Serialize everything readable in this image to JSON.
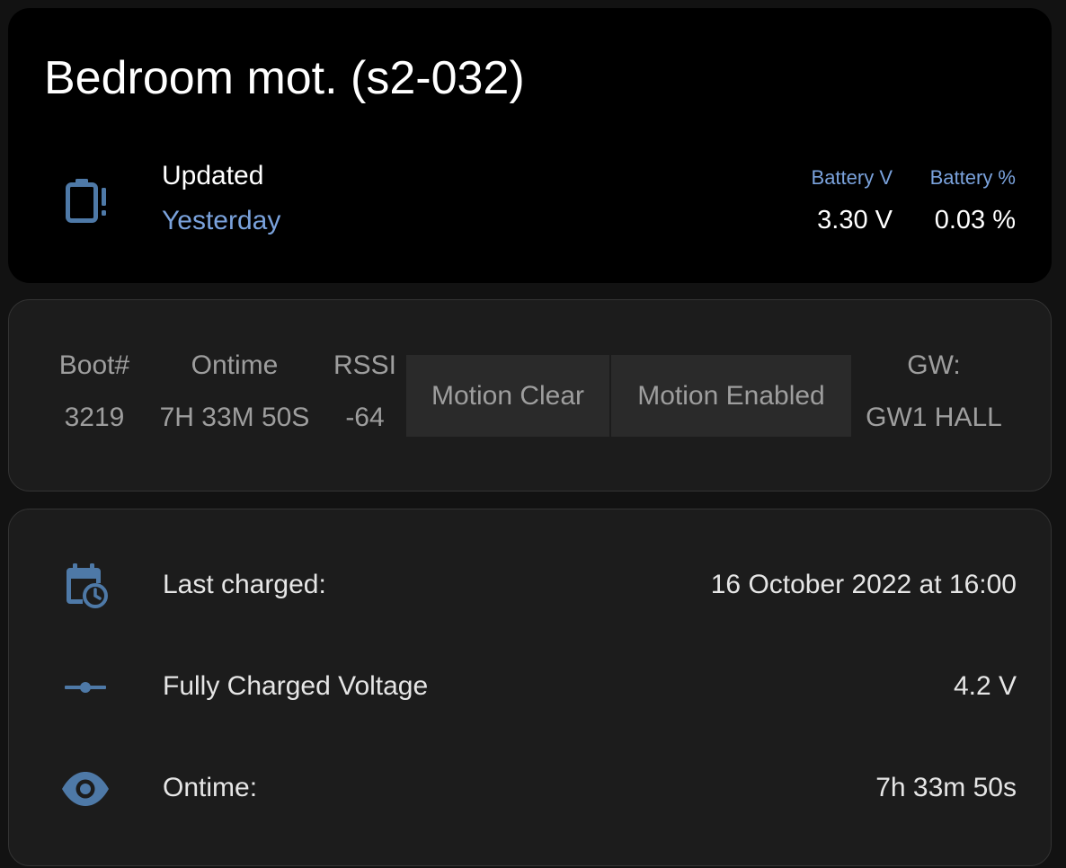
{
  "colors": {
    "accent": "#7aa2dc",
    "icon": "#4e79a7",
    "page_bg": "#121212",
    "card_bg": "#1c1c1c",
    "header_bg": "#000000"
  },
  "header": {
    "title": "Bedroom mot. (s2-032)",
    "icon": "battery-alert-icon",
    "updated_label": "Updated",
    "updated_value": "Yesterday",
    "metrics": [
      {
        "label": "Battery V",
        "value": "3.30 V"
      },
      {
        "label": "Battery %",
        "value": "0.03 %"
      }
    ]
  },
  "stats": {
    "boot": {
      "label": "Boot#",
      "value": "3219"
    },
    "ontime": {
      "label": "Ontime",
      "value": "7H 33M 50S"
    },
    "rssi": {
      "label": "RSSI",
      "value": "-64"
    },
    "motion_clear": "Motion Clear",
    "motion_enabled": "Motion Enabled",
    "gateway": {
      "label": "GW:",
      "value": "GW1 HALL"
    }
  },
  "details": [
    {
      "icon": "calendar-clock-icon",
      "label": "Last charged:",
      "value": "16 October 2022 at 16:00"
    },
    {
      "icon": "slider-icon",
      "label": "Fully Charged Voltage",
      "value": "4.2 V"
    },
    {
      "icon": "eye-icon",
      "label": "Ontime:",
      "value": "7h 33m 50s"
    }
  ]
}
